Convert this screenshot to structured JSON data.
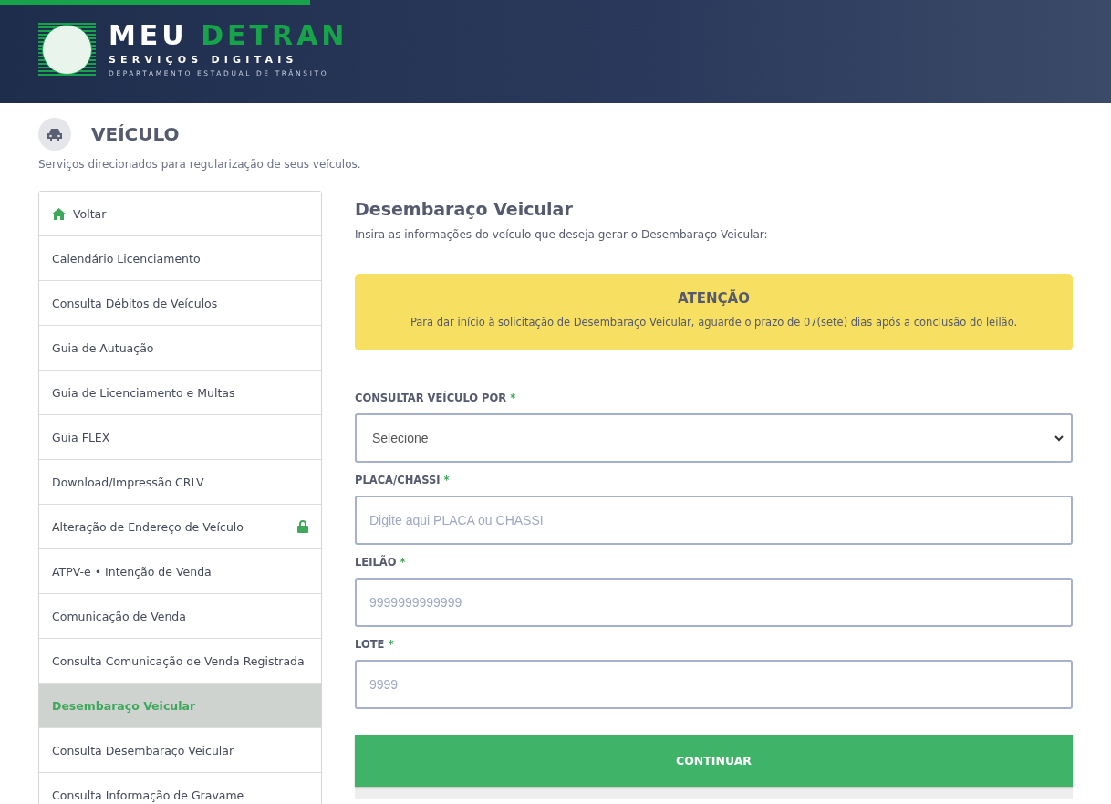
{
  "header": {
    "brand_first": "MEU",
    "brand_second": "DETRAN",
    "subtitle": "SERVIÇOS DIGITAIS",
    "department": "DEPARTAMENTO ESTADUAL DE TRÂNSITO"
  },
  "section": {
    "title": "VEÍCULO",
    "description": "Serviços direcionados para regularização de seus veículos."
  },
  "sidebar": {
    "items": [
      {
        "label": "Voltar",
        "kind": "back",
        "selected": false,
        "locked": false
      },
      {
        "label": "Calendário Licenciamento",
        "kind": "link",
        "selected": false,
        "locked": false
      },
      {
        "label": "Consulta Débitos de Veículos",
        "kind": "link",
        "selected": false,
        "locked": false
      },
      {
        "label": "Guia de Autuação",
        "kind": "link",
        "selected": false,
        "locked": false
      },
      {
        "label": "Guia de Licenciamento e Multas",
        "kind": "link",
        "selected": false,
        "locked": false
      },
      {
        "label": "Guia FLEX",
        "kind": "link",
        "selected": false,
        "locked": false
      },
      {
        "label": "Download/Impressão CRLV",
        "kind": "link",
        "selected": false,
        "locked": false
      },
      {
        "label": "Alteração de Endereço de Veículo",
        "kind": "link",
        "selected": false,
        "locked": true
      },
      {
        "label": "ATPV-e • Intenção de Venda",
        "kind": "link",
        "selected": false,
        "locked": false
      },
      {
        "label": "Comunicação de Venda",
        "kind": "link",
        "selected": false,
        "locked": false
      },
      {
        "label": "Consulta Comunicação de Venda Registrada",
        "kind": "link",
        "selected": false,
        "locked": false
      },
      {
        "label": "Desembaraço Veicular",
        "kind": "link",
        "selected": true,
        "locked": false
      },
      {
        "label": "Consulta Desembaraço Veicular",
        "kind": "link",
        "selected": false,
        "locked": false
      },
      {
        "label": "Consulta Informação de Gravame",
        "kind": "link",
        "selected": false,
        "locked": false
      }
    ]
  },
  "form": {
    "title": "Desembaraço Veicular",
    "intro": "Insira as informações do veículo que deseja gerar o Desembaraço Veicular:",
    "alert": {
      "title": "ATENÇÃO",
      "message": "Para dar início à solicitação de Desembaraço Veicular, aguarde o prazo de 07(sete) dias após a conclusão do leilão."
    },
    "fields": [
      {
        "kind": "select",
        "label": "CONSULTAR VEÍCULO POR",
        "required_mark": "*",
        "value": "Selecione"
      },
      {
        "kind": "text",
        "label": "PLACA/CHASSI",
        "required_mark": "*",
        "placeholder": "Digite aqui PLACA ou CHASSI"
      },
      {
        "kind": "text",
        "label": "LEILÃO",
        "required_mark": "*",
        "placeholder": "9999999999999"
      },
      {
        "kind": "text",
        "label": "LOTE",
        "required_mark": "*",
        "placeholder": "9999"
      }
    ],
    "submit": "CONTINUAR"
  }
}
